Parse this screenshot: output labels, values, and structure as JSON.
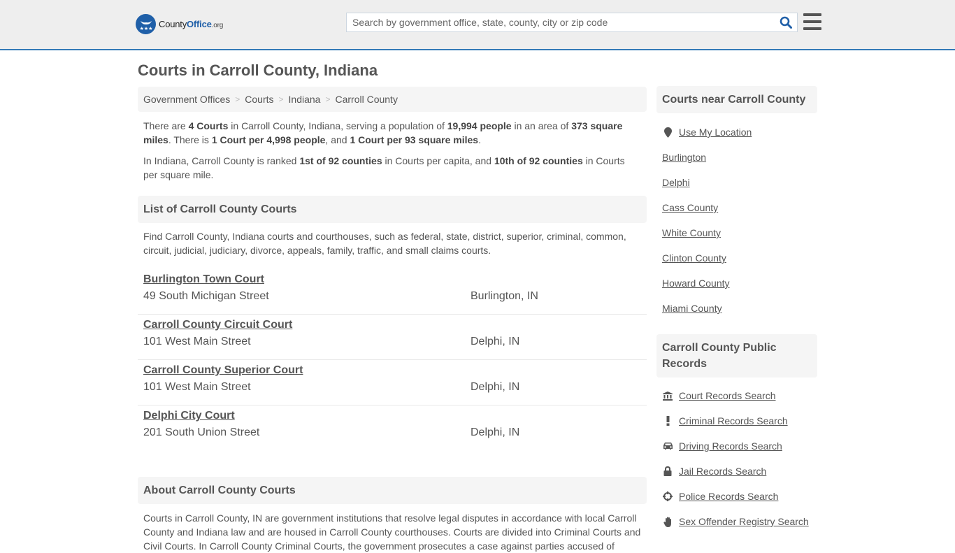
{
  "header": {
    "logo": {
      "county": "County",
      "office": "Office",
      "org": ".org"
    },
    "search": {
      "placeholder": "Search by government office, state, county, city or zip code",
      "value": ""
    },
    "icons": {
      "search": "search-icon",
      "menu": "hamburger-menu-icon"
    }
  },
  "page_title": "Courts in Carroll County, Indiana",
  "breadcrumb": [
    {
      "label": "Government Offices"
    },
    {
      "label": "Courts"
    },
    {
      "label": "Indiana"
    },
    {
      "label": "Carroll County"
    }
  ],
  "breadcrumb_separator": ">",
  "summary": {
    "p1": {
      "t1": "There are ",
      "b1": "4 Courts",
      "t2": " in Carroll County, Indiana, serving a population of ",
      "b2": "19,994 people",
      "t3": " in an area of ",
      "b3": "373 square miles",
      "t4": ". There is ",
      "b4": "1 Court per 4,998 people",
      "t5": ", and ",
      "b5": "1 Court per 93 square miles",
      "t6": "."
    },
    "p2": {
      "t1": "In Indiana, Carroll County is ranked ",
      "b1": "1st of 92 counties",
      "t2": " in Courts per capita, and ",
      "b2": "10th of 92 counties",
      "t3": " in Courts per square mile."
    }
  },
  "list_section": {
    "title": "List of Carroll County Courts",
    "intro": "Find Carroll County, Indiana courts and courthouses, such as federal, state, district, superior, criminal, common, circuit, judicial, judiciary, divorce, appeals, family, traffic, and small claims courts.",
    "courts": [
      {
        "name": "Burlington Town Court",
        "address": "49 South Michigan Street",
        "city": "Burlington, IN"
      },
      {
        "name": "Carroll County Circuit Court",
        "address": "101 West Main Street",
        "city": "Delphi, IN"
      },
      {
        "name": "Carroll County Superior Court",
        "address": "101 West Main Street",
        "city": "Delphi, IN"
      },
      {
        "name": "Delphi City Court",
        "address": "201 South Union Street",
        "city": "Delphi, IN"
      }
    ]
  },
  "about_section": {
    "title": "About Carroll County Courts",
    "text": "Courts in Carroll County, IN are government institutions that resolve legal disputes in accordance with local Carroll County and Indiana law and are housed in Carroll County courthouses. Courts are divided into Criminal Courts and Civil Courts. In Carroll County Criminal Courts, the government prosecutes a case against parties accused of"
  },
  "sidebar": {
    "near": {
      "title": "Courts near Carroll County",
      "use_location": "Use My Location",
      "items": [
        "Burlington",
        "Delphi",
        "Cass County",
        "White County",
        "Clinton County",
        "Howard County",
        "Miami County"
      ]
    },
    "records": {
      "title": "Carroll County Public Records",
      "items": [
        {
          "label": "Court Records Search",
          "icon": "courthouse-icon"
        },
        {
          "label": "Criminal Records Search",
          "icon": "exclamation-icon"
        },
        {
          "label": "Driving Records Search",
          "icon": "car-icon"
        },
        {
          "label": "Jail Records Search",
          "icon": "lock-icon"
        },
        {
          "label": "Police Records Search",
          "icon": "crosshairs-icon"
        },
        {
          "label": "Sex Offender Registry Search",
          "icon": "hand-icon"
        }
      ]
    }
  },
  "colors": {
    "accent": "#337ab7",
    "logo_blue": "#1f5fa8",
    "text": "#555555",
    "panel_bg": "#f5f5f5",
    "header_bg": "#eeeeee"
  }
}
